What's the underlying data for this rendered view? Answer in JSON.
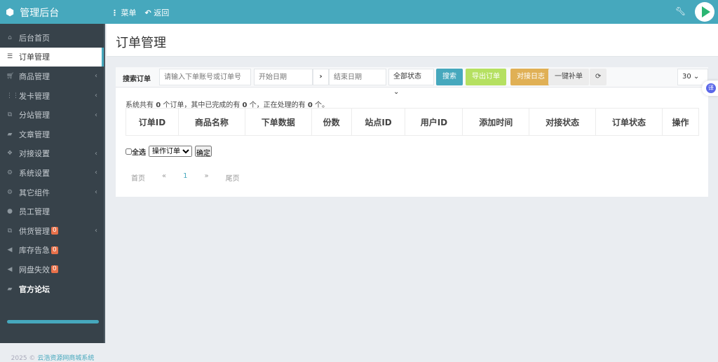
{
  "header": {
    "title": "管理后台",
    "menu": "菜单",
    "back": "返回"
  },
  "sidebar": {
    "items": [
      {
        "label": "后台首页",
        "icon": "home-icon"
      },
      {
        "label": "订单管理",
        "icon": "list-icon",
        "active": true
      },
      {
        "label": "商品管理",
        "icon": "cart-icon"
      },
      {
        "label": "发卡管理",
        "icon": "grid-icon"
      },
      {
        "label": "分站管理",
        "icon": "sitemap-icon"
      },
      {
        "label": "文章管理",
        "icon": "book-icon"
      },
      {
        "label": "对接设置",
        "icon": "cubes-icon"
      },
      {
        "label": "系统设置",
        "icon": "gear-icon"
      },
      {
        "label": "其它组件",
        "icon": "cogs-icon"
      },
      {
        "label": "员工管理",
        "icon": "user-icon"
      },
      {
        "label": "供货管理",
        "icon": "sitemap-icon",
        "badge": "0"
      },
      {
        "label": "库存告急",
        "icon": "bullhorn-icon",
        "badge": "0"
      },
      {
        "label": "网盘失效",
        "icon": "bullhorn-icon",
        "badge": "0"
      },
      {
        "label": "官方论坛",
        "icon": "book-icon"
      }
    ],
    "footer_year": "2025 ©",
    "footer_link": "云浩资源网商城系统"
  },
  "page": {
    "title": "订单管理"
  },
  "toolbar": {
    "label": "搜索订单",
    "search_placeholder": "请输入下单账号或订单号",
    "start_placeholder": "开始日期",
    "end_placeholder": "结束日期",
    "status": "全部状态",
    "search": "搜索",
    "export": "导出订单",
    "log": "对接日志",
    "refill": "一键补单",
    "page_size": "30"
  },
  "summary": {
    "prefix": "系统共有",
    "total": "0",
    "mid1": "个订单，其中已完成的有",
    "done": "0",
    "mid2": "个，正在处理的有",
    "processing": "0",
    "suffix": "个。"
  },
  "table": {
    "columns": [
      "订单ID",
      "商品名称",
      "下单数据",
      "份数",
      "站点ID",
      "用户ID",
      "添加时间",
      "对接状态",
      "订单状态",
      "操作"
    ]
  },
  "bulk": {
    "select_all": "全选",
    "action": "操作订单",
    "confirm": "确定"
  },
  "pager": {
    "first": "首页",
    "prev": "«",
    "current": "1",
    "next": "»",
    "last": "尾页"
  },
  "translate": "译"
}
